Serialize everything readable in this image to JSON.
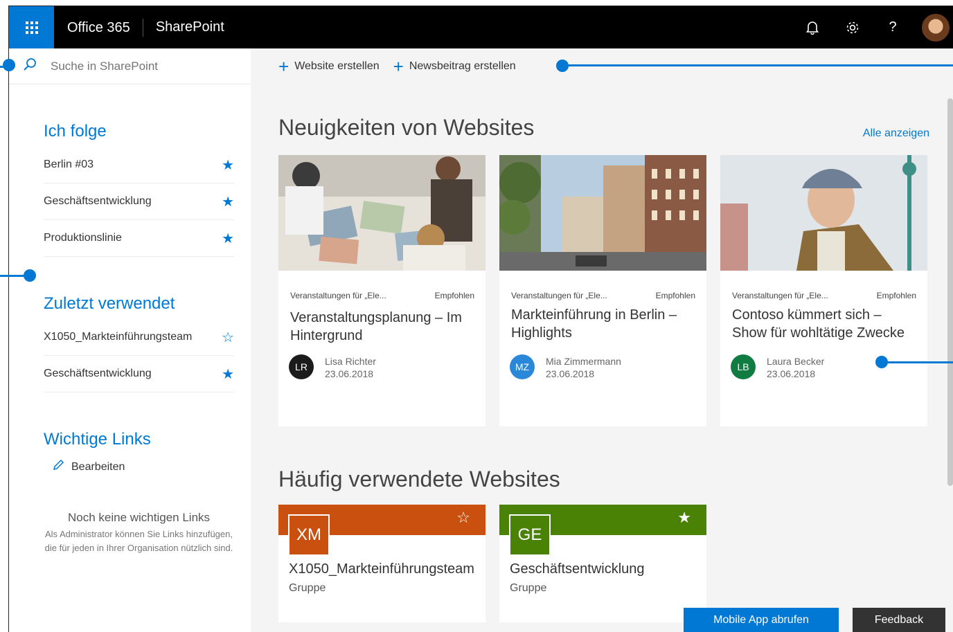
{
  "suitebar": {
    "brand": "Office 365",
    "app_name": "SharePoint",
    "icons": [
      "bell-icon",
      "gear-icon",
      "help-icon",
      "avatar"
    ],
    "help_glyph": "?"
  },
  "search": {
    "placeholder": "Suche in SharePoint"
  },
  "commands": [
    {
      "label": "Website erstellen"
    },
    {
      "label": "Newsbeitrag erstellen"
    }
  ],
  "left_nav": {
    "following": {
      "title": "Ich folge",
      "items": [
        {
          "label": "Berlin #03",
          "starred": true
        },
        {
          "label": "Geschäftsentwicklung",
          "starred": true
        },
        {
          "label": "Produktionslinie",
          "starred": true
        }
      ]
    },
    "recent": {
      "title": "Zuletzt verwendet",
      "items": [
        {
          "label": "X1050_Markteinführungsteam",
          "starred": false
        },
        {
          "label": "Geschäftsentwicklung",
          "starred": true
        }
      ]
    },
    "links": {
      "title": "Wichtige Links",
      "edit_label": "Bearbeiten",
      "empty_title": "Noch keine wichtigen Links",
      "empty_text": "Als Administrator können Sie Links hinzufügen, die für jeden in Ihrer Organisation nützlich sind."
    }
  },
  "news": {
    "title": "Neuigkeiten von Websites",
    "view_all": "Alle anzeigen",
    "cards": [
      {
        "source": "Veranstaltungen für „Ele...",
        "tag": "Empfohlen",
        "title": "Veranstaltungsplanung – Im Hintergrund",
        "initials": "LR",
        "author": "Lisa Richter",
        "date": "23.06.2018",
        "avatar_color": "#1b1b1b"
      },
      {
        "source": "Veranstaltungen für „Ele...",
        "tag": "Empfohlen",
        "title": "Markteinführung in Berlin – Highlights",
        "initials": "MZ",
        "author": "Mia Zimmermann",
        "date": "23.06.2018",
        "avatar_color": "#2b88d8"
      },
      {
        "source": "Veranstaltungen für „Ele...",
        "tag": "Empfohlen",
        "title": "Contoso kümmert sich – Show für wohltätige Zwecke",
        "initials": "LB",
        "author": "Laura Becker",
        "date": "23.06.2018",
        "avatar_color": "#107c41"
      }
    ]
  },
  "frequent": {
    "title": "Häufig verwendete Websites",
    "sites": [
      {
        "abbr": "XM",
        "name": "X1050_Markteinführungsteam",
        "type": "Gruppe",
        "color": "#ca5010",
        "tile_color": "#ca5010",
        "starred": false
      },
      {
        "abbr": "GE",
        "name": "Geschäftsentwicklung",
        "type": "Gruppe",
        "color": "#498205",
        "tile_color": "#498205",
        "starred": true
      }
    ]
  },
  "footer": {
    "mobile_label": "Mobile App abrufen",
    "feedback_label": "Feedback"
  },
  "colors": {
    "accent": "#0078d4",
    "suitebar": "#000000"
  }
}
